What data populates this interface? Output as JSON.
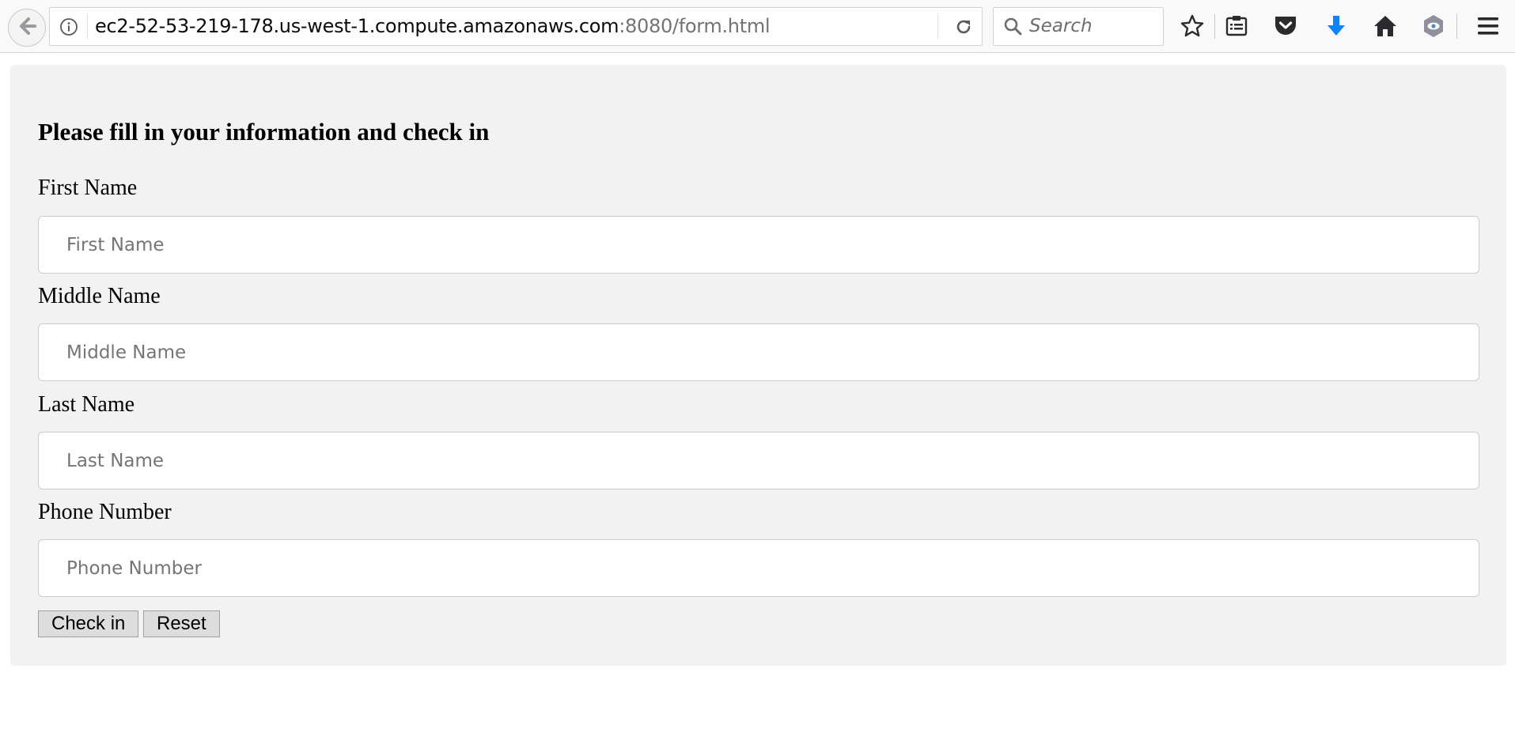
{
  "browser": {
    "url_host": "ec2-52-53-219-178.us-west-1.compute.amazonaws.com",
    "url_path": ":8080/form.html",
    "search_placeholder": "Search",
    "icons": [
      "back-arrow-icon",
      "info-icon",
      "reload-icon",
      "search-icon",
      "bookmark-star-icon",
      "reader-list-icon",
      "pocket-icon",
      "download-icon",
      "home-icon",
      "extension-icon",
      "menu-icon"
    ],
    "accent_color": "#0a84ff"
  },
  "form": {
    "title": "Please fill in your information and check in",
    "fields": [
      {
        "label": "First Name",
        "placeholder": "First Name",
        "value": ""
      },
      {
        "label": "Middle Name",
        "placeholder": "Middle Name",
        "value": ""
      },
      {
        "label": "Last Name",
        "placeholder": "Last Name",
        "value": ""
      },
      {
        "label": "Phone Number",
        "placeholder": "Phone Number",
        "value": ""
      }
    ],
    "submit_label": "Check in",
    "reset_label": "Reset",
    "panel_color": "#f2f2f2"
  }
}
